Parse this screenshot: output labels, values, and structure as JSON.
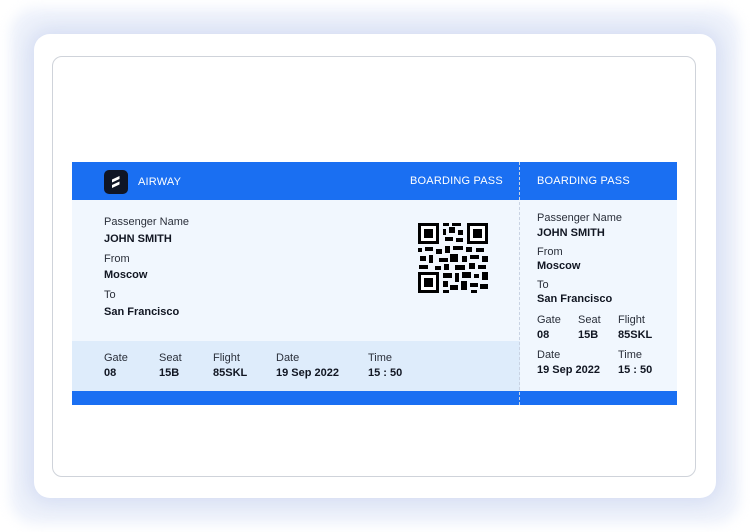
{
  "brand": {
    "name": "AIRWAY",
    "logo_icon": "airway-logo-icon"
  },
  "colors": {
    "accent": "#1a6ff2",
    "ticket_bg": "#f1f7fe",
    "info_band": "#deecfb"
  },
  "main": {
    "header_title": "BOARDING PASS",
    "passenger_label": "Passenger Name",
    "passenger_value": "JOHN SMITH",
    "from_label": "From",
    "from_value": "Moscow",
    "to_label": "To",
    "to_value": "San Francisco",
    "gate_label": "Gate",
    "gate_value": "08",
    "seat_label": "Seat",
    "seat_value": "15B",
    "flight_label": "Flight",
    "flight_value": "85SKL",
    "date_label": "Date",
    "date_value": "19 Sep 2022",
    "time_label": "Time",
    "time_value": "15 : 50",
    "qr_icon": "qr-code-icon"
  },
  "stub": {
    "header_title": "BOARDING PASS",
    "passenger_label": "Passenger Name",
    "passenger_value": "JOHN SMITH",
    "from_label": "From",
    "from_value": "Moscow",
    "to_label": "To",
    "to_value": "San Francisco",
    "gate_label": "Gate",
    "gate_value": "08",
    "seat_label": "Seat",
    "seat_value": "15B",
    "flight_label": "Flight",
    "flight_value": "85SKL",
    "date_label": "Date",
    "date_value": "19 Sep 2022",
    "time_label": "Time",
    "time_value": "15 : 50"
  }
}
